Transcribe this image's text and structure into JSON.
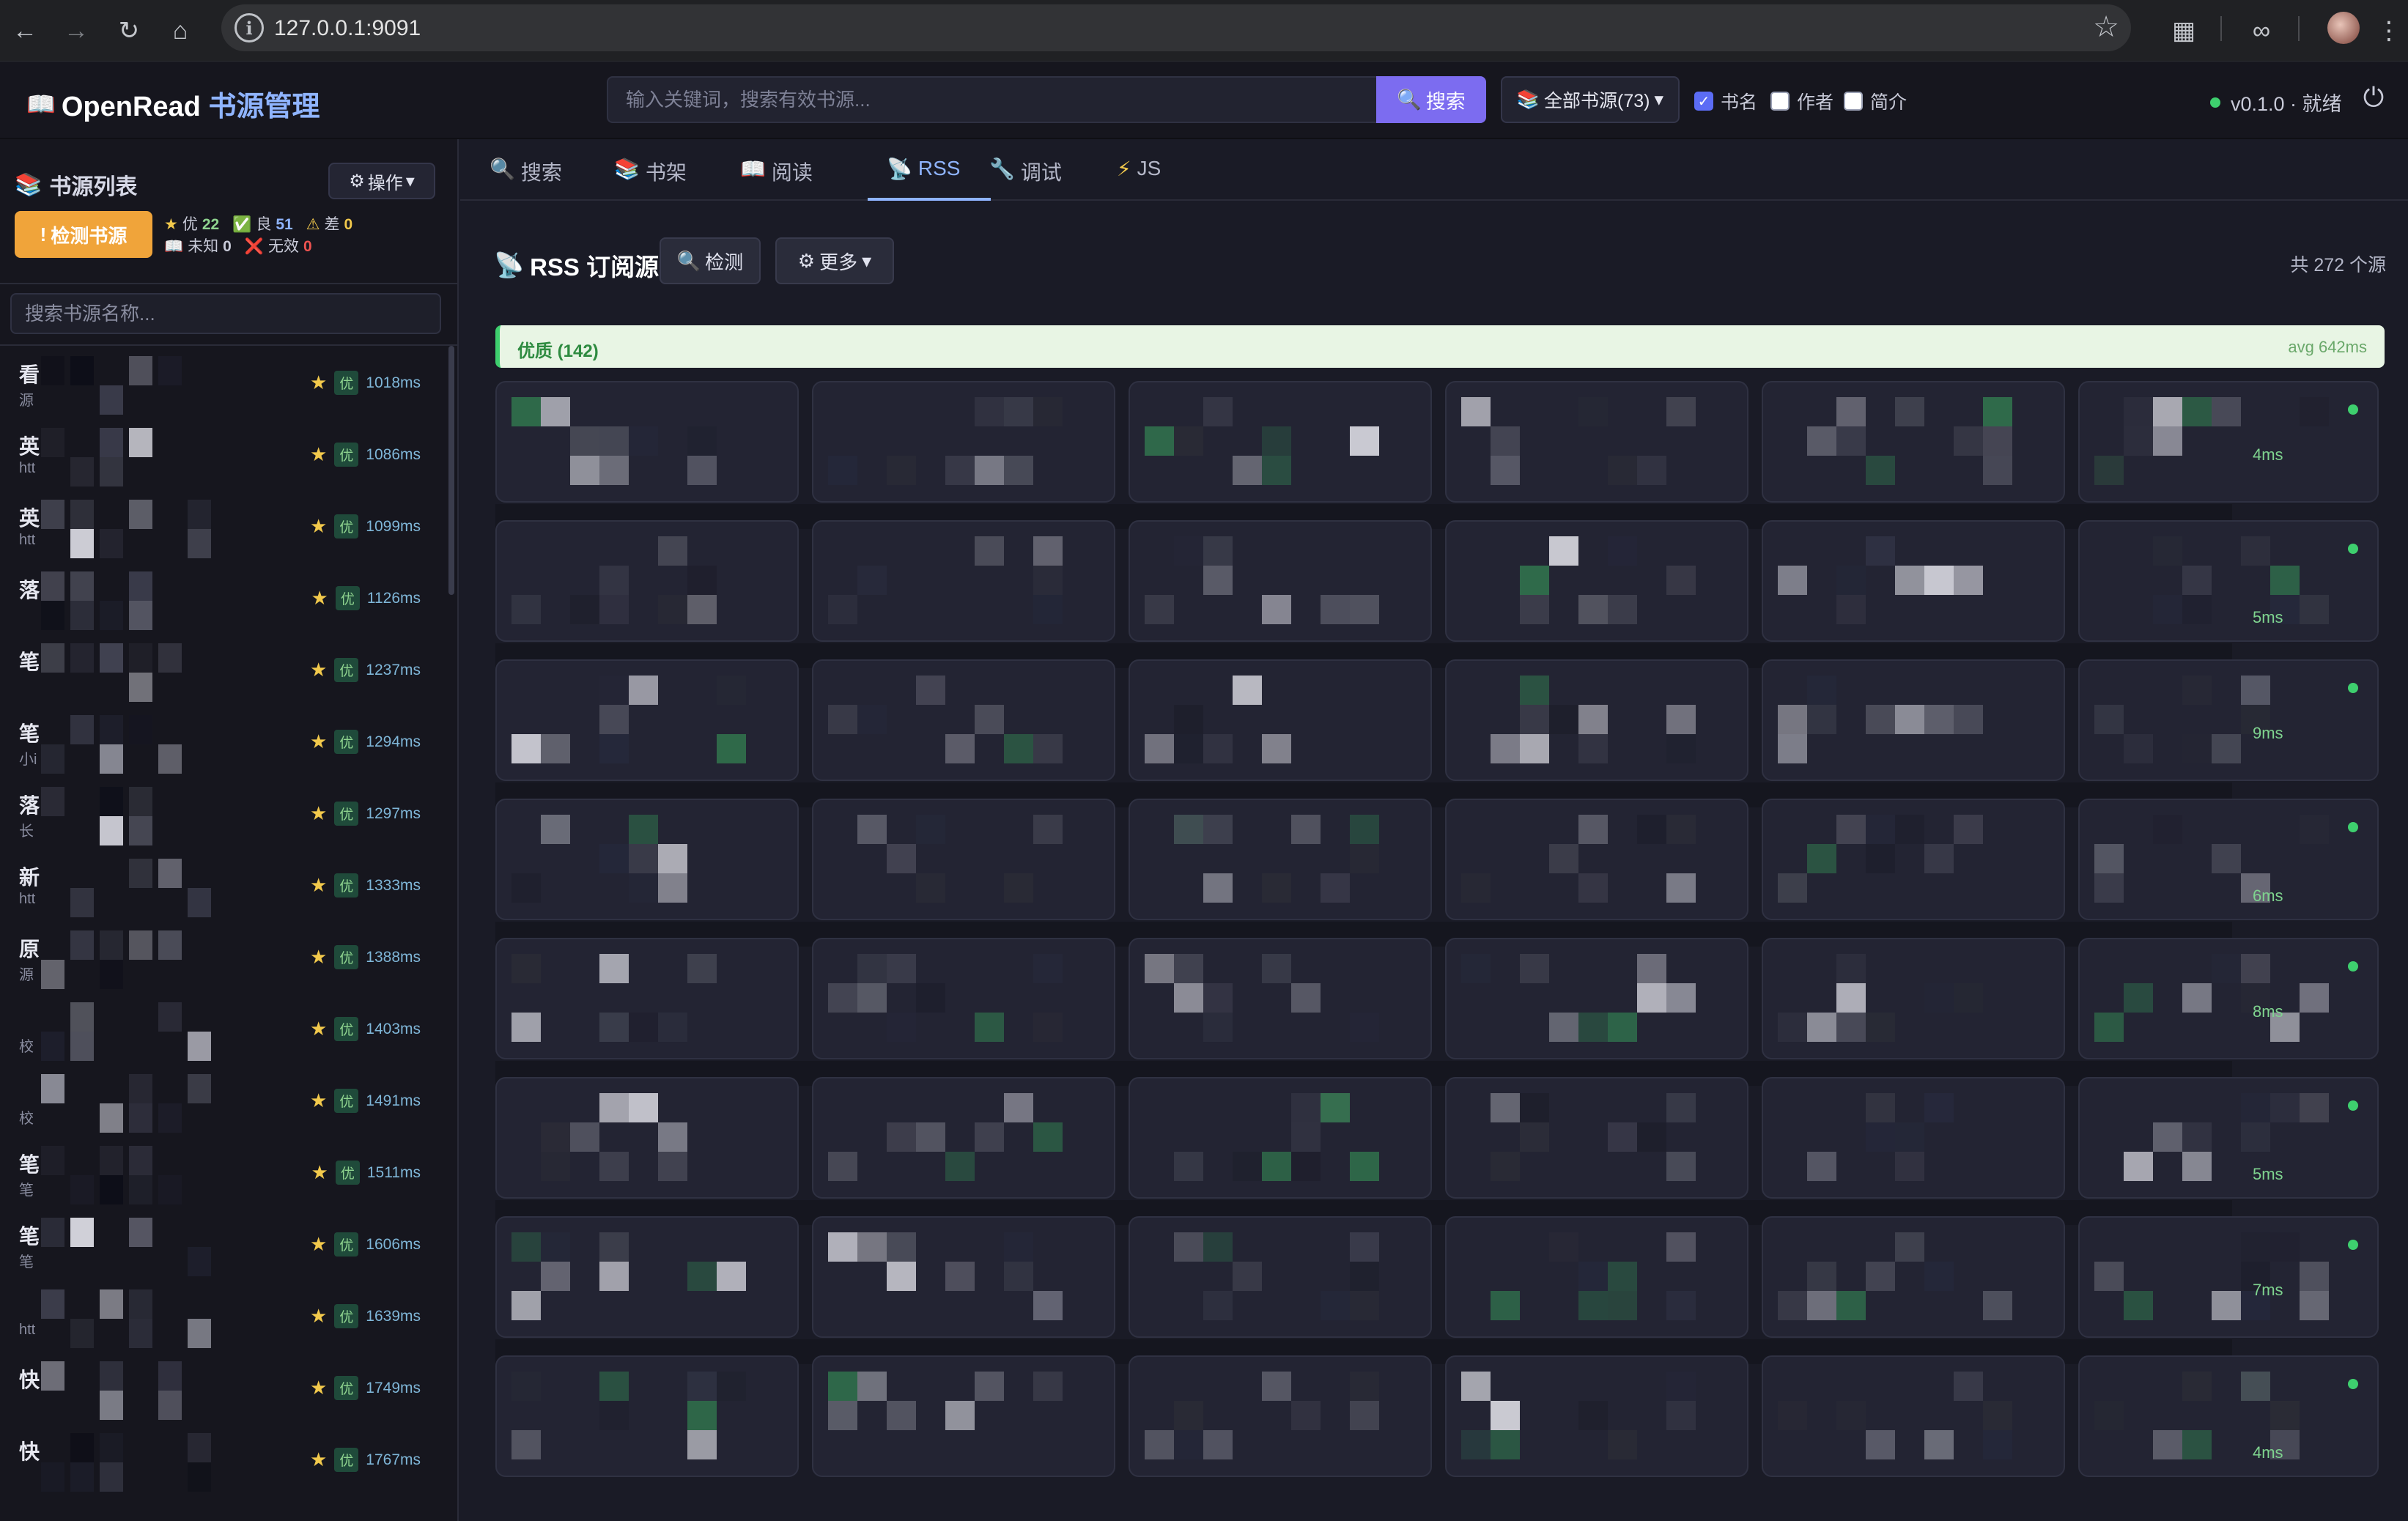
{
  "browser": {
    "url": "127.0.0.1:9091"
  },
  "header": {
    "brand_prefix": "OpenRead",
    "brand_suffix": "书源管理",
    "search_placeholder": "输入关键词，搜索有效书源...",
    "search_button": "搜索",
    "scope_button": "全部书源(73)",
    "filters": [
      {
        "label": "书名",
        "checked": true
      },
      {
        "label": "作者",
        "checked": false
      },
      {
        "label": "简介",
        "checked": false
      }
    ],
    "status": "v0.1.0 · 就绪"
  },
  "sidebar": {
    "title": "书源列表",
    "ops_button": "操作",
    "check_button": "检测书源",
    "stats": {
      "excellent_label": "优",
      "excellent_count": "22",
      "good_label": "良",
      "good_count": "51",
      "bad_label": "差",
      "bad_count": "0",
      "unknown_label": "未知",
      "unknown_count": "0",
      "invalid_label": "无效",
      "invalid_count": "0"
    },
    "search_placeholder": "搜索书源名称...",
    "items": [
      {
        "title": "看",
        "sub": "源",
        "badge": "优",
        "ms": "1018ms"
      },
      {
        "title": "英",
        "sub": "htt",
        "badge": "优",
        "ms": "1086ms"
      },
      {
        "title": "英",
        "sub": "htt",
        "badge": "优",
        "ms": "1099ms"
      },
      {
        "title": "落",
        "sub": "",
        "badge": "优",
        "ms": "1126ms"
      },
      {
        "title": "笔",
        "sub": "",
        "badge": "优",
        "ms": "1237ms"
      },
      {
        "title": "笔",
        "sub": "小i",
        "badge": "优",
        "ms": "1294ms"
      },
      {
        "title": "落",
        "sub": "长",
        "badge": "优",
        "ms": "1297ms"
      },
      {
        "title": "新",
        "sub": "htt",
        "badge": "优",
        "ms": "1333ms"
      },
      {
        "title": "原",
        "sub": "源",
        "badge": "优",
        "ms": "1388ms"
      },
      {
        "title": "",
        "sub": "校",
        "badge": "优",
        "ms": "1403ms"
      },
      {
        "title": "",
        "sub": "校",
        "badge": "优",
        "ms": "1491ms"
      },
      {
        "title": "笔",
        "sub": "笔",
        "badge": "优",
        "ms": "1511ms"
      },
      {
        "title": "笔",
        "sub": "笔",
        "badge": "优",
        "ms": "1606ms"
      },
      {
        "title": "",
        "sub": "htt",
        "badge": "优",
        "ms": "1639ms"
      },
      {
        "title": "快",
        "sub": "",
        "badge": "优",
        "ms": "1749ms"
      },
      {
        "title": "快",
        "sub": "",
        "badge": "优",
        "ms": "1767ms"
      }
    ]
  },
  "tabs": [
    {
      "icon": "search-icon",
      "label": "搜索"
    },
    {
      "icon": "books-icon",
      "label": "书架"
    },
    {
      "icon": "book-open-icon",
      "label": "阅读"
    },
    {
      "icon": "satellite-icon",
      "label": "RSS"
    },
    {
      "icon": "wrench-icon",
      "label": "调试"
    },
    {
      "icon": "lightning-icon",
      "label": "JS"
    }
  ],
  "active_tab": "RSS",
  "rss": {
    "title": "RSS 订阅源",
    "check_button": "检测",
    "more_button": "更多",
    "total": "共 272 个源",
    "group_label": "优质 (142)",
    "group_avg": "avg 642ms",
    "card_times": [
      "4ms",
      "5ms",
      "9ms",
      "6ms",
      "8ms",
      "5ms",
      "7ms",
      "4ms"
    ]
  },
  "colors": {
    "accent": "#7c6cf0",
    "link": "#8fb4ff",
    "ok": "#3ecf6e",
    "warn": "#f0a43a"
  }
}
